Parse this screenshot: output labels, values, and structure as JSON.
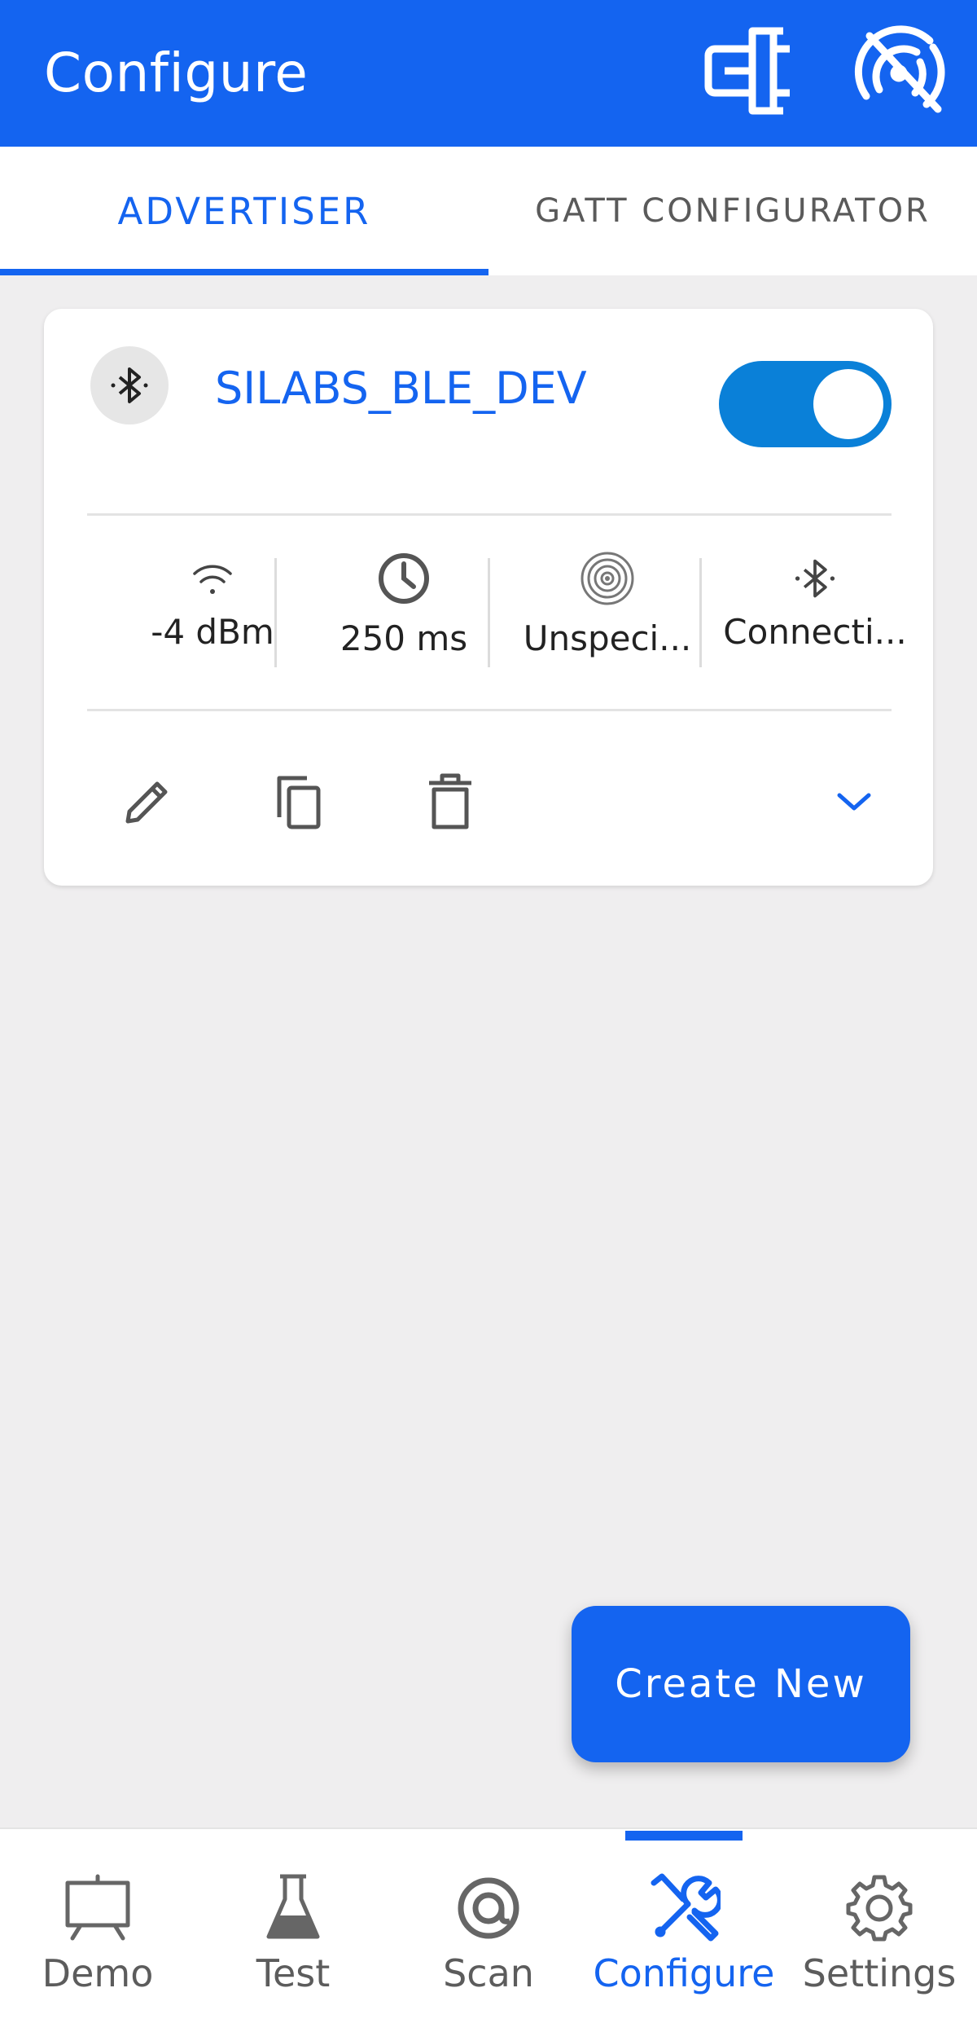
{
  "appbar": {
    "title": "Configure",
    "icons": [
      "device-icon",
      "advertise-off-icon"
    ]
  },
  "tabs": {
    "advertiser": "ADVERTISER",
    "gatt": "GATT CONFIGURATOR",
    "active": "advertiser"
  },
  "advertiser_card": {
    "name": "SILABS_BLE_DEV",
    "enabled": true,
    "stats": [
      {
        "icon": "wifi-signal-icon",
        "label": "-4 dBm"
      },
      {
        "icon": "clock-icon",
        "label": "250 ms"
      },
      {
        "icon": "broadcast-icon",
        "label": "Unspeci..."
      },
      {
        "icon": "bluetooth-icon",
        "label": "Connecti..."
      }
    ],
    "actions": [
      "edit-icon",
      "copy-icon",
      "delete-icon",
      "expand-icon"
    ]
  },
  "fab": {
    "label": "Create New"
  },
  "bottom_nav": {
    "items": [
      {
        "label": "Demo",
        "icon": "easel-icon"
      },
      {
        "label": "Test",
        "icon": "flask-icon"
      },
      {
        "label": "Scan",
        "icon": "scan-icon"
      },
      {
        "label": "Configure",
        "icon": "tools-icon"
      },
      {
        "label": "Settings",
        "icon": "gear-icon"
      }
    ],
    "active": "Configure"
  },
  "colors": {
    "primary": "#1464f0",
    "toggle": "#0a80d8",
    "background": "#efeeef"
  }
}
